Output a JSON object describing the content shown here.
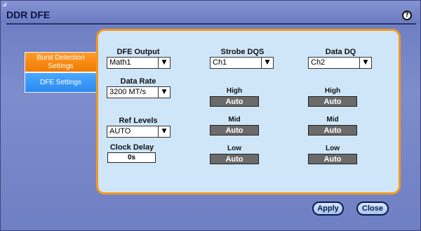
{
  "window": {
    "title": "DDR DFE"
  },
  "tabs": [
    {
      "label": "Burst Detection Settings"
    },
    {
      "label": "DFE Settings"
    }
  ],
  "dfe_output": {
    "label": "DFE Output",
    "value": "Math1"
  },
  "data_rate": {
    "label": "Data Rate",
    "value": "3200 MT/s"
  },
  "ref_levels": {
    "label": "Ref Levels",
    "value": "AUTO"
  },
  "clock_delay": {
    "label": "Clock Delay",
    "value": "0s"
  },
  "strobe_dqs": {
    "label": "Strobe DQS",
    "value": "Ch1",
    "high_label": "High",
    "high_value": "Auto",
    "mid_label": "Mid",
    "mid_value": "Auto",
    "low_label": "Low",
    "low_value": "Auto"
  },
  "data_dq": {
    "label": "Data DQ",
    "value": "Ch2",
    "high_label": "High",
    "high_value": "Auto",
    "mid_label": "Mid",
    "mid_value": "Auto",
    "low_label": "Low",
    "low_value": "Auto"
  },
  "buttons": {
    "apply": "Apply",
    "close": "Close"
  },
  "colors": {
    "accent_orange": "#f07c00",
    "accent_blue": "#2c8af0",
    "panel": "#cfe6f9"
  }
}
